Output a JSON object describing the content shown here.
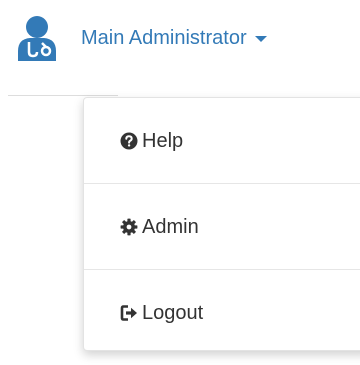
{
  "colors": {
    "link": "#337ab7",
    "text": "#333333",
    "menu_border": "#e3e3e3",
    "divider": "#e6e6e6"
  },
  "user_menu": {
    "name": "Main Administrator",
    "avatar_icon": "user-doctor-icon",
    "caret_icon": "caret-down-icon"
  },
  "dropdown": {
    "items": [
      {
        "label": "Help",
        "icon": "question-circle-icon"
      },
      {
        "label": "Admin",
        "icon": "gear-icon"
      },
      {
        "label": "Logout",
        "icon": "sign-out-icon"
      }
    ]
  }
}
